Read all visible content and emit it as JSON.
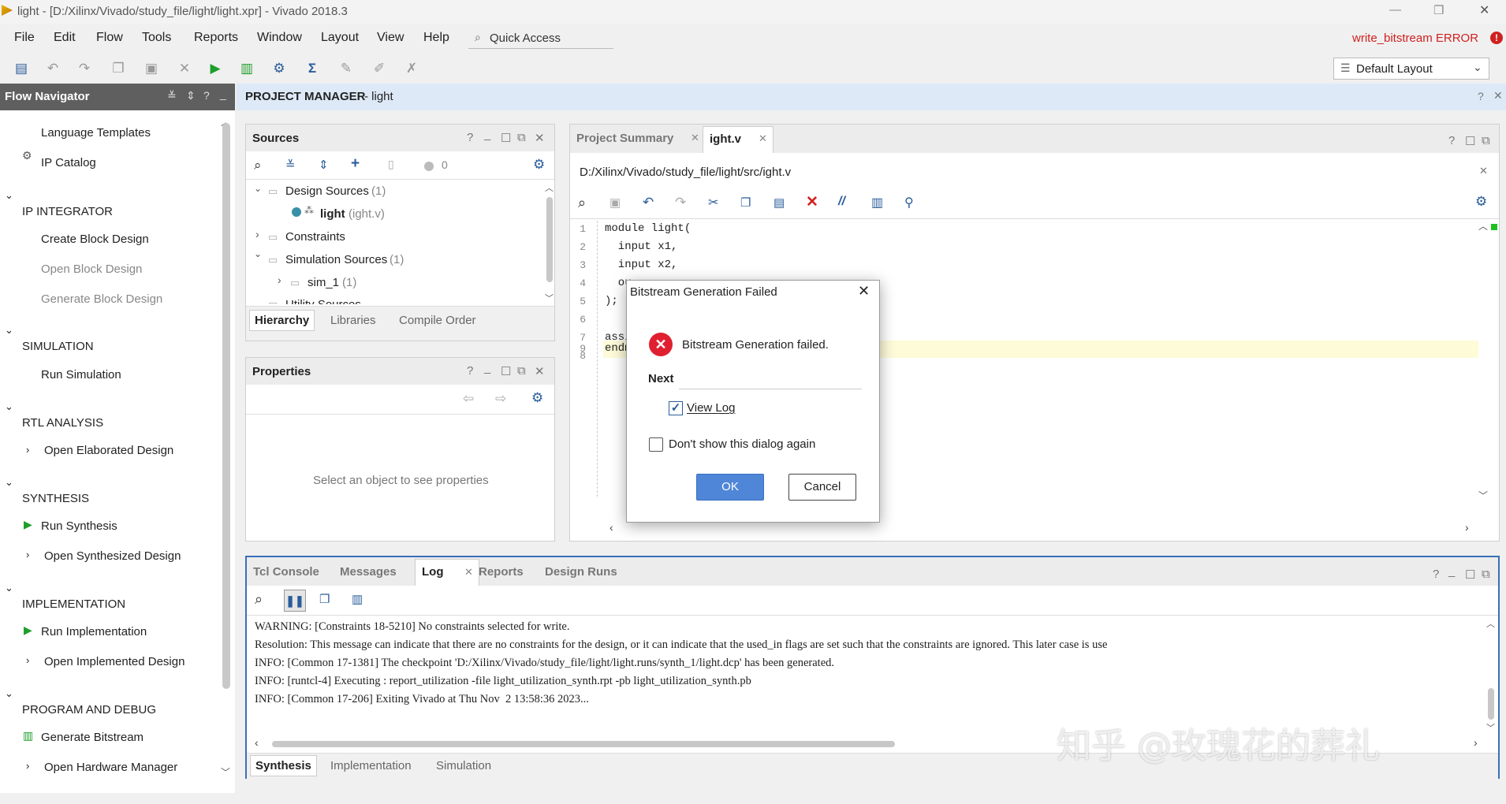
{
  "window": {
    "title": "light - [D:/Xilinx/Vivado/study_file/light/light.xpr] - Vivado 2018.3",
    "controls": [
      "—",
      "❐",
      "✕"
    ]
  },
  "menu": [
    "File",
    "Edit",
    "Flow",
    "Tools",
    "Reports",
    "Window",
    "Layout",
    "View",
    "Help"
  ],
  "quick_access": "Quick Access",
  "status": {
    "text": "write_bitstream ERROR",
    "color": "#d02020"
  },
  "layout_select": "Default Layout",
  "flow_navigator": {
    "title": "Flow Navigator",
    "items_top": [
      "Language Templates",
      "IP Catalog"
    ],
    "sections": [
      {
        "name": "IP INTEGRATOR",
        "items": [
          "Create Block Design",
          "Open Block Design",
          "Generate Block Design"
        ]
      },
      {
        "name": "SIMULATION",
        "items": [
          "Run Simulation"
        ]
      },
      {
        "name": "RTL ANALYSIS",
        "items": [
          "Open Elaborated Design"
        ]
      },
      {
        "name": "SYNTHESIS",
        "items": [
          "Run Synthesis",
          "Open Synthesized Design"
        ]
      },
      {
        "name": "IMPLEMENTATION",
        "items": [
          "Run Implementation",
          "Open Implemented Design"
        ]
      },
      {
        "name": "PROGRAM AND DEBUG",
        "items": [
          "Generate Bitstream",
          "Open Hardware Manager"
        ]
      }
    ]
  },
  "project_manager": {
    "title": "PROJECT MANAGER",
    "suffix": "- light"
  },
  "sources": {
    "title": "Sources",
    "count": "0",
    "tree": {
      "design": "Design Sources",
      "design_count": "(1)",
      "light": "light",
      "light_file": "(ight.v)",
      "constraints": "Constraints",
      "sim": "Simulation Sources",
      "sim_count": "(1)",
      "sim1": "sim_1",
      "sim1_count": "(1)",
      "utility": "Utility Sources"
    },
    "tabs": [
      "Hierarchy",
      "Libraries",
      "Compile Order"
    ]
  },
  "properties": {
    "title": "Properties",
    "placeholder": "Select an object to see properties"
  },
  "editor": {
    "tabs": [
      "Project Summary",
      "ight.v"
    ],
    "path": "D:/Xilinx/Vivado/study_file/light/src/ight.v",
    "lines": [
      {
        "n": "1",
        "text": "module light("
      },
      {
        "n": "2",
        "text": "  input x1,"
      },
      {
        "n": "3",
        "text": "  input x2,"
      },
      {
        "n": "4",
        "text": "  ou"
      },
      {
        "n": "5",
        "text": ");"
      },
      {
        "n": "6",
        "text": ""
      },
      {
        "n": "7",
        "text": "assi"
      },
      {
        "n": "8",
        "text": ""
      },
      {
        "n": "9",
        "text": "endm"
      }
    ]
  },
  "dialog": {
    "title": "Bitstream Generation Failed",
    "message": "Bitstream Generation failed.",
    "next_label": "Next",
    "view_log": "View Log",
    "view_log_checked": true,
    "dont_show": "Don't show this dialog again",
    "dont_show_checked": false,
    "ok": "OK",
    "cancel": "Cancel"
  },
  "console": {
    "tabs": [
      "Tcl Console",
      "Messages",
      "Log",
      "Reports",
      "Design Runs"
    ],
    "log": [
      "WARNING: [Constraints 18-5210] No constraints selected for write.",
      "Resolution: This message can indicate that there are no constraints for the design, or it can indicate that the used_in flags are set such that the constraints are ignored. This later case is use",
      "INFO: [Common 17-1381] The checkpoint 'D:/Xilinx/Vivado/study_file/light/light.runs/synth_1/light.dcp' has been generated.",
      "INFO: [runtcl-4] Executing : report_utilization -file light_utilization_synth.rpt -pb light_utilization_synth.pb",
      "INFO: [Common 17-206] Exiting Vivado at Thu Nov  2 13:58:36 2023..."
    ],
    "bottom_tabs": [
      "Synthesis",
      "Implementation",
      "Simulation"
    ]
  },
  "watermark": "知乎 @玫瑰花的葬礼"
}
